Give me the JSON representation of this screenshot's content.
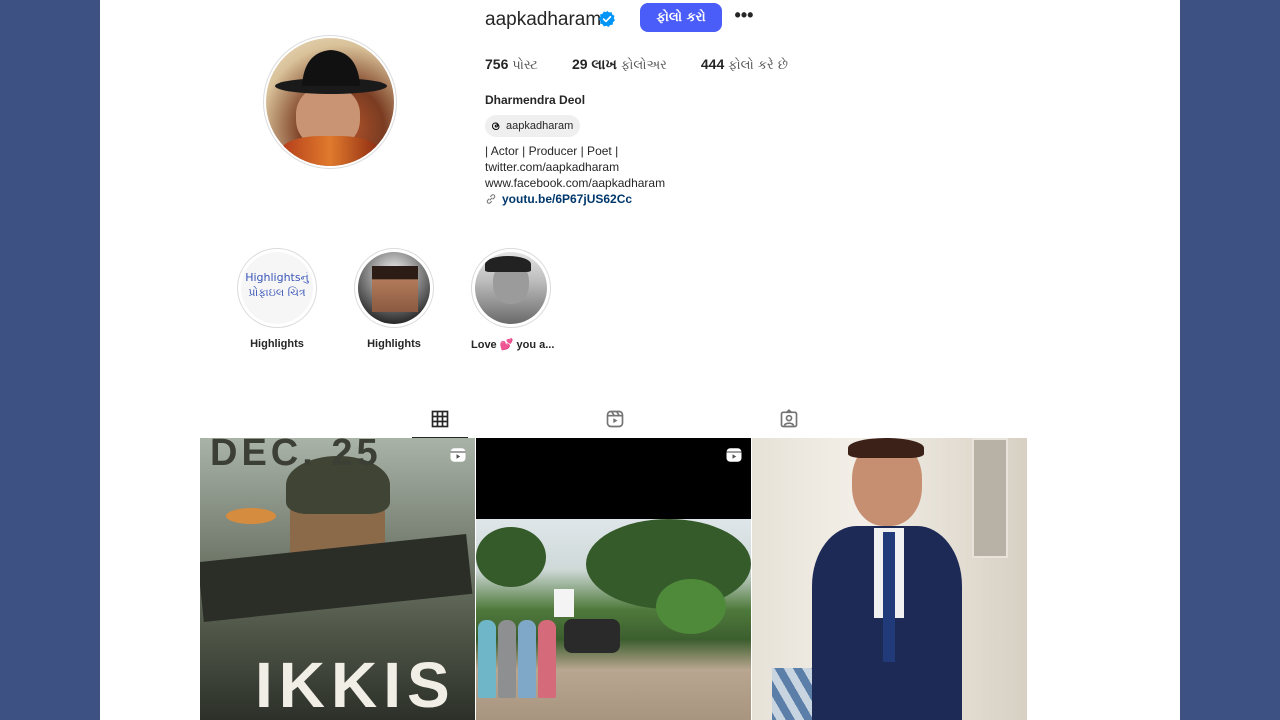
{
  "profile": {
    "username": "aapkadharam",
    "follow_label": "ફોલો કરો",
    "more_label": "•••",
    "full_name": "Dharmendra Deol",
    "threads_handle": "aapkadharam",
    "bio_lines": [
      "| Actor | Producer | Poet |",
      "twitter.com/aapkadharam",
      "www.facebook.com/aapkadharam"
    ],
    "link": "youtu.be/6P67jUS62Cc"
  },
  "stats": [
    {
      "value": "756",
      "label": "પોસ્ટ"
    },
    {
      "value": "29 લાખ",
      "label": "ફોલોઅર"
    },
    {
      "value": "444",
      "label": "ફોલો કરે છે"
    }
  ],
  "highlights": [
    {
      "label": "Highlights",
      "image_text": [
        "Highlightsનું",
        "પ્રોફાઇલ ચિત્ર"
      ]
    },
    {
      "label": "Highlights"
    },
    {
      "label": "Love 💕 you a..."
    }
  ],
  "posts": [
    {
      "text_top": "DEC. 25",
      "text_bottom": "IKKIS",
      "type": "reel"
    },
    {
      "type": "reel"
    },
    {
      "type": "photo"
    }
  ],
  "colors": {
    "page_background": "#3e5183",
    "follow_button": "#4a5df9",
    "verified_badge": "#0095f6",
    "link": "#00376b"
  },
  "icons": [
    "verified-badge-icon",
    "threads-icon",
    "link-icon",
    "grid-icon",
    "reels-icon",
    "tagged-icon",
    "reel-icon"
  ]
}
